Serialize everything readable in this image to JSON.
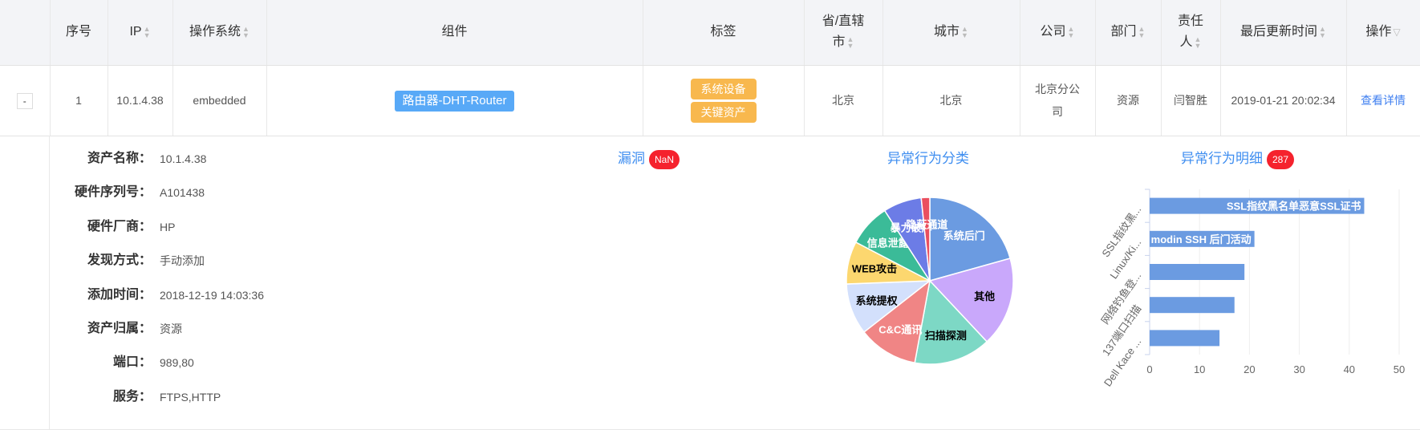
{
  "table": {
    "headers": [
      {
        "label": "",
        "sortable": false
      },
      {
        "label": "序号",
        "sortable": false
      },
      {
        "label": "IP",
        "sortable": true
      },
      {
        "label": "操作系统",
        "sortable": true
      },
      {
        "label": "组件",
        "sortable": false
      },
      {
        "label": "标签",
        "sortable": false
      },
      {
        "label": "省/直辖市",
        "sortable": true
      },
      {
        "label": "城市",
        "sortable": true
      },
      {
        "label": "公司",
        "sortable": true
      },
      {
        "label": "部门",
        "sortable": true
      },
      {
        "label": "责任人",
        "sortable": true
      },
      {
        "label": "最后更新时间",
        "sortable": true
      },
      {
        "label": "操作",
        "filter": true
      }
    ],
    "row": {
      "expand": "-",
      "index": "1",
      "ip": "10.1.4.38",
      "os": "embedded",
      "component": "路由器-DHT-Router",
      "tags": [
        "系统设备",
        "关键资产"
      ],
      "province": "北京",
      "city": "北京",
      "company": "北京分公司",
      "department": "资源",
      "owner": "闫智胜",
      "updated": "2019-01-21 20:02:34",
      "action": "查看详情"
    }
  },
  "detail": {
    "fields": [
      {
        "label": "资产名称：",
        "value": "10.1.4.38"
      },
      {
        "label": "硬件序列号：",
        "value": "A101438"
      },
      {
        "label": "硬件厂商：",
        "value": "HP"
      },
      {
        "label": "发现方式：",
        "value": "手动添加"
      },
      {
        "label": "添加时间：",
        "value": "2018-12-19 14:03:36"
      },
      {
        "label": "资产归属：",
        "value": "资源"
      },
      {
        "label": "端口：",
        "value": "989,80"
      },
      {
        "label": "服务：",
        "value": "FTPS,HTTP"
      }
    ],
    "vuln": {
      "title": "漏洞",
      "badge": "NaN"
    },
    "category_title": "异常行为分类",
    "detail_title": "异常行为明细",
    "detail_badge": "287"
  },
  "colors": {
    "accent": "#3f8ef0",
    "badge": "#f5222d",
    "tag": "#f8b84e",
    "component": "#58a9f7",
    "bar": "#6b9be1"
  },
  "chart_data": [
    {
      "type": "pie",
      "title": "异常行为分类",
      "slices": [
        {
          "label": "系统后门",
          "value": 25,
          "color": "#6b9be1",
          "text": "#fff"
        },
        {
          "label": "其他",
          "value": 21,
          "color": "#c9a8fb",
          "text": "#000"
        },
        {
          "label": "扫描探测",
          "value": 18,
          "color": "#7dd8c5",
          "text": "#000"
        },
        {
          "label": "C&C通讯",
          "value": 14,
          "color": "#f08585",
          "text": "#fff"
        },
        {
          "label": "系统提权",
          "value": 12,
          "color": "#d3e0fc",
          "text": "#000"
        },
        {
          "label": "WEB攻击",
          "value": 10,
          "color": "#fcd76f",
          "text": "#000"
        },
        {
          "label": "信息泄露",
          "value": 10,
          "color": "#3bbb98",
          "text": "#fff"
        },
        {
          "label": "暴力破解",
          "value": 9,
          "color": "#6c7ce6",
          "text": "#fff"
        },
        {
          "label": "隐蔽通道",
          "value": 2,
          "color": "#ea4f5f",
          "text": "#fff"
        }
      ]
    },
    {
      "type": "bar",
      "orientation": "horizontal",
      "title": "异常行为明细",
      "categories": [
        "SSL指纹黑...",
        "Linux/Ki...",
        "网络钓鱼登...",
        "137端口扫描",
        "Dell Kace ..."
      ],
      "values": [
        43,
        21,
        19,
        17,
        14
      ],
      "bar_labels": [
        "SSL指纹黑名单恶意SSL证书",
        "modin SSH 后门活动",
        "",
        "",
        ""
      ],
      "xlim": [
        0,
        50
      ],
      "xticks": [
        0,
        10,
        20,
        30,
        40,
        50
      ],
      "grid": true
    }
  ]
}
